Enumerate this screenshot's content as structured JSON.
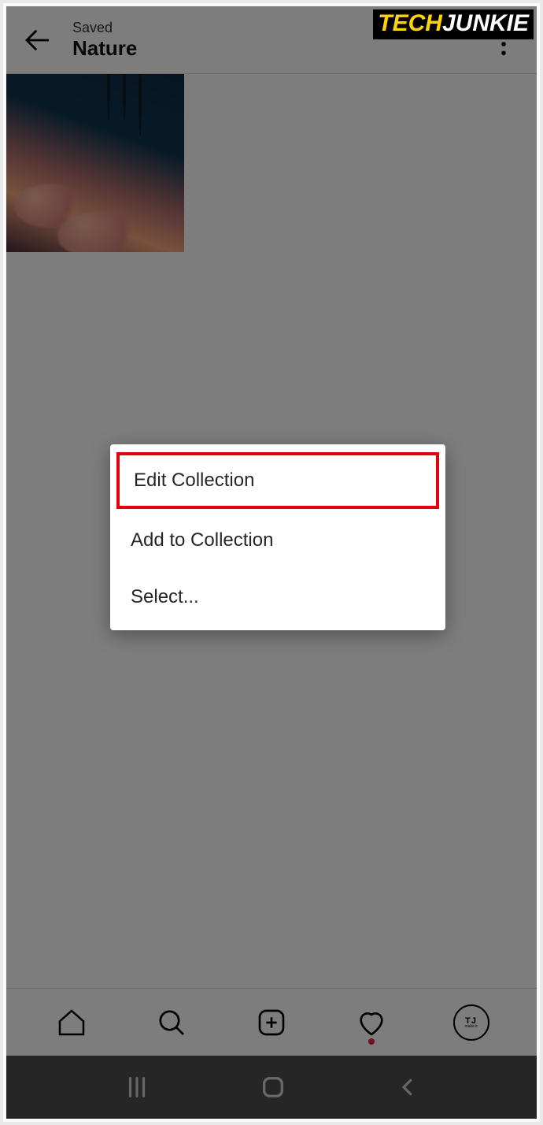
{
  "header": {
    "subtitle": "Saved",
    "title": "Nature"
  },
  "menu": {
    "items": [
      {
        "label": "Edit Collection",
        "highlighted": true
      },
      {
        "label": "Add to Collection",
        "highlighted": false
      },
      {
        "label": "Select...",
        "highlighted": false
      }
    ]
  },
  "watermark": {
    "part1": "TECH",
    "part2": "JUNKIE"
  },
  "avatar": {
    "initials": "TJ",
    "tagline": "make it"
  }
}
